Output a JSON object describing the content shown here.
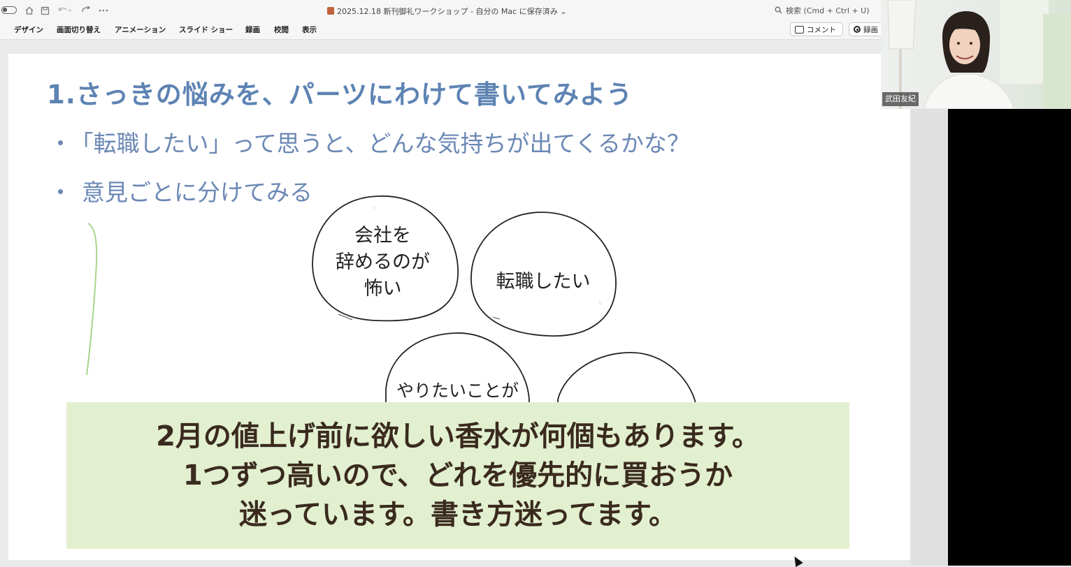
{
  "window": {
    "document_title": "2025.12.18 新刊御礼ワークショップ - 自分の Mac に保存済み ⌄",
    "search_placeholder": "検索 (Cmd + Ctrl + U)"
  },
  "icons": {
    "toggle": "sidebar-toggle-icon",
    "home": "home-icon",
    "save": "save-icon",
    "undo": "undo-icon",
    "redo": "redo-icon",
    "more": "more-icon",
    "search": "search-icon",
    "comment": "comment-icon",
    "record": "record-icon"
  },
  "ribbon": {
    "tabs": [
      "デザイン",
      "画面切り替え",
      "アニメーション",
      "スライド ショー",
      "録画",
      "校閲",
      "表示"
    ],
    "comment_label": "コメント",
    "record_label": "録画"
  },
  "slide": {
    "title": "1.さっきの悩みを、パーツにわけて書いてみよう",
    "bullet_marker": "・",
    "bullets": [
      "「転職したい」って思うと、どんな気持ちが出てくるかな？",
      "意見ごとに分けてみる"
    ],
    "bubbles": [
      {
        "lines": [
          "会社を",
          "辞めるのが",
          "怖い"
        ]
      },
      {
        "lines": [
          "転職したい"
        ]
      },
      {
        "lines": [
          "やりたいことが"
        ]
      },
      {
        "lines": []
      }
    ]
  },
  "caption": {
    "lines": [
      "2月の値上げ前に欲しい香水が何個もあります。",
      "1つずつ高いので、どれを優先的に買おうか",
      "迷っています。書き方迷ってます。"
    ]
  },
  "participant": {
    "name": "武田友紀"
  },
  "colors": {
    "title": "#5d83b3",
    "bullet": "#6b88b5",
    "caption_bg": "#e2f0d0",
    "caption_text": "#3a2a1e"
  }
}
